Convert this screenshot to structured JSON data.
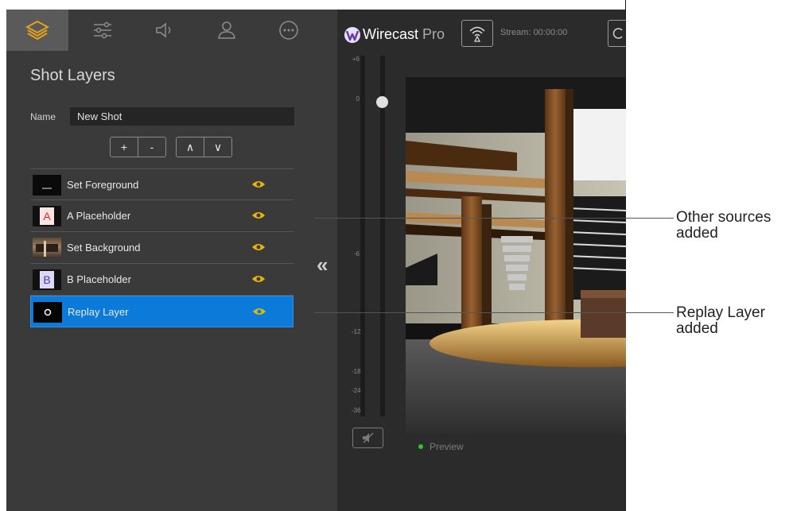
{
  "tabs": [
    {
      "icon": "layers-icon",
      "active": true
    },
    {
      "icon": "sliders-icon",
      "active": false
    },
    {
      "icon": "speaker-icon",
      "active": false
    },
    {
      "icon": "person-icon",
      "active": false
    },
    {
      "icon": "more-icon",
      "active": false
    }
  ],
  "panel_title": "Shot Layers",
  "name_field": {
    "label": "Name",
    "value": "New Shot"
  },
  "layer_buttons": {
    "add": "+",
    "remove": "-",
    "up": "∧",
    "down": "∨"
  },
  "layers": [
    {
      "label": "Set Foreground",
      "thumb": "foreground",
      "visible": true,
      "selected": false
    },
    {
      "label": "A Placeholder",
      "thumb": "A",
      "visible": true,
      "selected": false
    },
    {
      "label": "Set Background",
      "thumb": "background",
      "visible": true,
      "selected": false
    },
    {
      "label": "B Placeholder",
      "thumb": "B",
      "visible": true,
      "selected": false
    },
    {
      "label": "Replay Layer",
      "thumb": "replay",
      "visible": true,
      "selected": true
    }
  ],
  "collapse_symbol": "«",
  "header": {
    "brand": "Wirecast",
    "edition": "Pro",
    "stream_status": "Stream: 00:00:00"
  },
  "meter": {
    "ticks": [
      "+6",
      "0",
      "-6",
      "-12",
      "-18",
      "-24",
      "-36"
    ]
  },
  "preview": {
    "label": "Preview"
  },
  "callouts": [
    {
      "line1": "Other sources",
      "line2": "added"
    },
    {
      "line1": "Replay Layer",
      "line2": "added"
    }
  ],
  "colors": {
    "accent": "#0b7ad8",
    "eye": "#e6b800",
    "panel": "#3a3a3a",
    "preview_dot": "#2ec42e"
  }
}
